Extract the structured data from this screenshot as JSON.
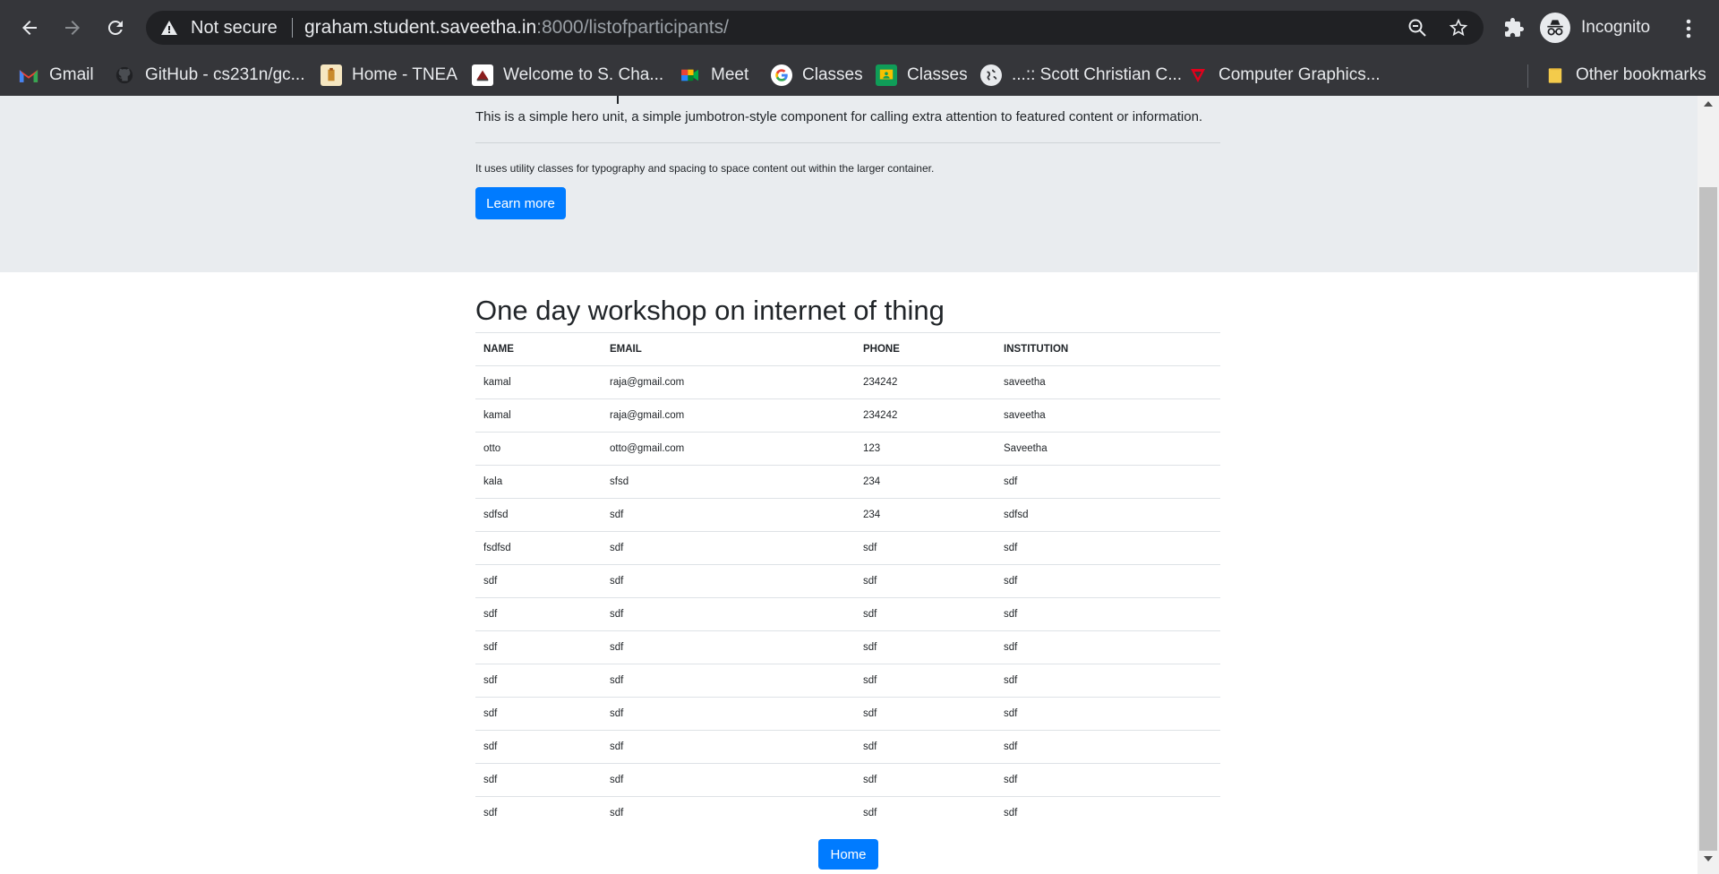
{
  "browser": {
    "security_label": "Not secure",
    "url_host": "graham.student.saveetha.in",
    "url_rest": ":8000/listofparticipants/",
    "profile_label": "Incognito",
    "bookmarks": [
      {
        "label": "Gmail",
        "icon": "gmail-icon"
      },
      {
        "label": "GitHub - cs231n/gc...",
        "icon": "github-icon"
      },
      {
        "label": "Home - TNEA",
        "icon": "tnea-icon"
      },
      {
        "label": "Welcome to S. Cha...",
        "icon": "site-icon"
      },
      {
        "label": "Meet",
        "icon": "meet-icon"
      },
      {
        "label": "Classes",
        "icon": "google-icon"
      },
      {
        "label": "Classes",
        "icon": "classroom-icon"
      },
      {
        "label": "...:: Scott Christian C...",
        "icon": "globe-icon"
      },
      {
        "label": "Computer Graphics...",
        "icon": "cg-icon"
      }
    ],
    "other_bookmarks": "Other bookmarks"
  },
  "hero": {
    "lead": "This is a simple hero unit, a simple jumbotron-style component for calling extra attention to featured content or information.",
    "text": "It uses utility classes for typography and spacing to space content out within the larger container.",
    "button": "Learn more"
  },
  "page": {
    "heading": "One day workshop on internet of thing",
    "home_button": "Home"
  },
  "table": {
    "headers": [
      "NAME",
      "EMAIL",
      "PHONE",
      "INSTITUTION"
    ],
    "rows": [
      [
        "kamal",
        "raja@gmail.com",
        "234242",
        "saveetha"
      ],
      [
        "kamal",
        "raja@gmail.com",
        "234242",
        "saveetha"
      ],
      [
        "otto",
        "otto@gmail.com",
        "123",
        "Saveetha"
      ],
      [
        "kala",
        "sfsd",
        "234",
        "sdf"
      ],
      [
        "sdfsd",
        "sdf",
        "234",
        "sdfsd"
      ],
      [
        "fsdfsd",
        "sdf",
        "sdf",
        "sdf"
      ],
      [
        "sdf",
        "sdf",
        "sdf",
        "sdf"
      ],
      [
        "sdf",
        "sdf",
        "sdf",
        "sdf"
      ],
      [
        "sdf",
        "sdf",
        "sdf",
        "sdf"
      ],
      [
        "sdf",
        "sdf",
        "sdf",
        "sdf"
      ],
      [
        "sdf",
        "sdf",
        "sdf",
        "sdf"
      ],
      [
        "sdf",
        "sdf",
        "sdf",
        "sdf"
      ],
      [
        "sdf",
        "sdf",
        "sdf",
        "sdf"
      ],
      [
        "sdf",
        "sdf",
        "sdf",
        "sdf"
      ]
    ]
  },
  "colors": {
    "chrome": "#35363a",
    "omnibox": "#202124",
    "primary": "#007bff",
    "jumbotron": "#e9ecef"
  }
}
